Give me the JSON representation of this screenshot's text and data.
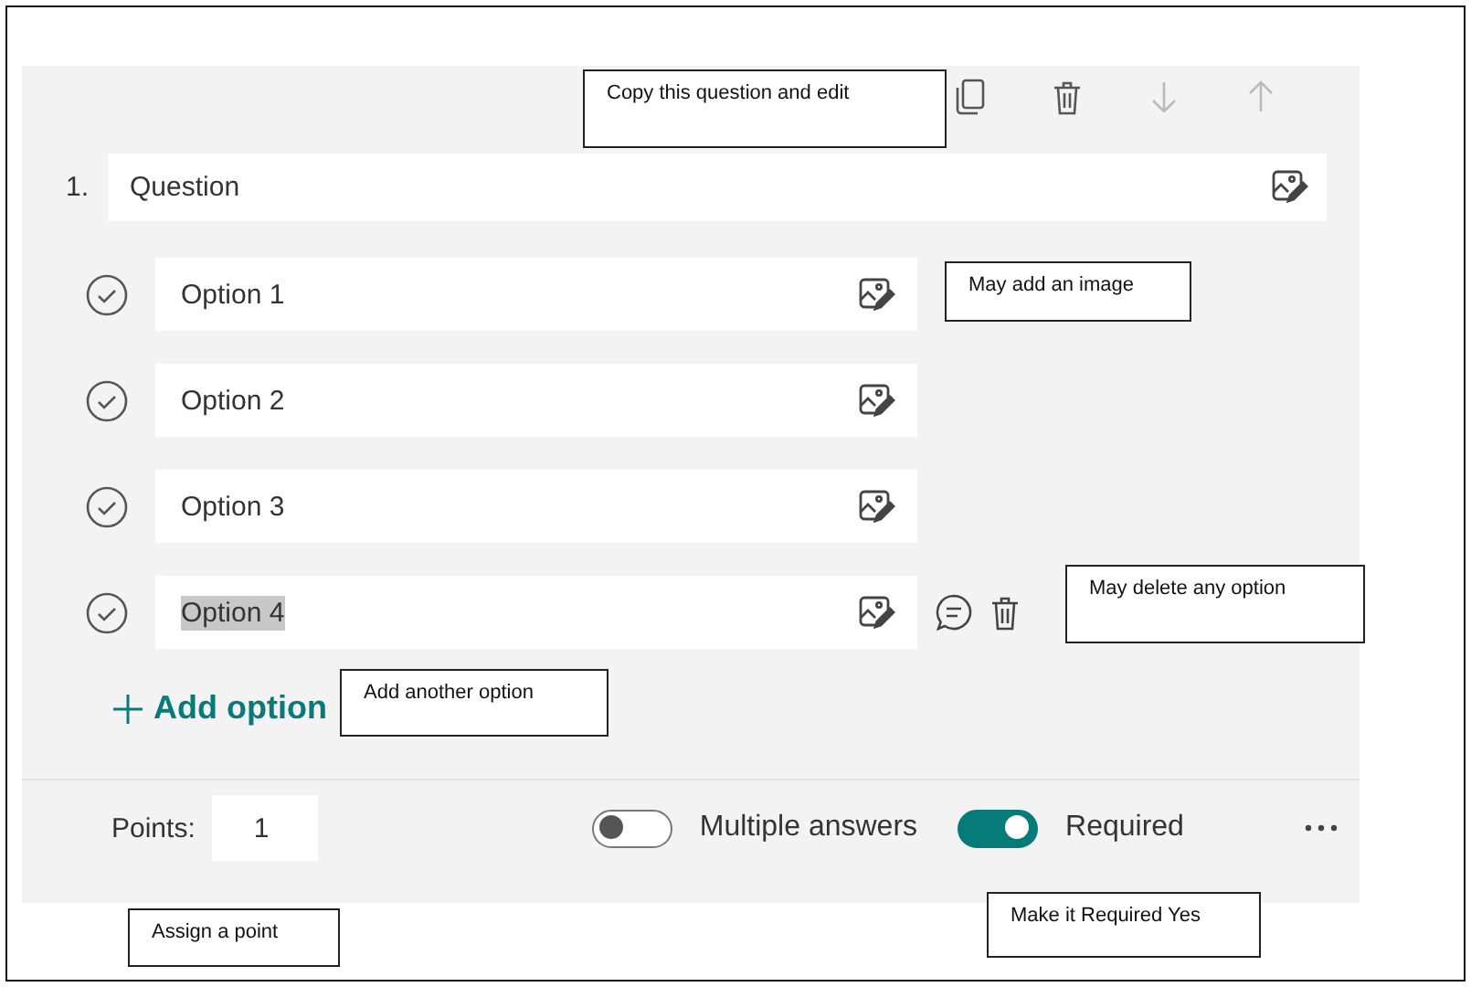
{
  "toolbar": [
    {
      "kind": "copy",
      "disabled": false
    },
    {
      "kind": "delete",
      "disabled": false
    },
    {
      "kind": "down",
      "disabled": true
    },
    {
      "kind": "up",
      "disabled": true
    }
  ],
  "question": {
    "number": "1.",
    "value": "Question"
  },
  "options": [
    {
      "value": "Option 1",
      "text_selected": false,
      "show_actions": false
    },
    {
      "value": "Option 2",
      "text_selected": false,
      "show_actions": false
    },
    {
      "value": "Option 3",
      "text_selected": false,
      "show_actions": false
    },
    {
      "value": "Option 4",
      "text_selected": true,
      "show_actions": true
    }
  ],
  "add_option": {
    "label": "Add option"
  },
  "footer": {
    "points_label": "Points:",
    "points_value": "1",
    "toggles": [
      {
        "label": "Multiple answers",
        "on": false
      },
      {
        "label": "Required",
        "on": true
      }
    ]
  },
  "callouts": [
    {
      "text": "Copy this question and edit",
      "kind": "copy"
    },
    {
      "text": "May add an image",
      "kind": "image"
    },
    {
      "text": "May delete any option",
      "kind": "delete"
    },
    {
      "text": "Add another option",
      "kind": "add"
    },
    {
      "text": "Assign a point",
      "kind": "points"
    },
    {
      "text": "Make it Required Yes",
      "kind": "required"
    }
  ]
}
